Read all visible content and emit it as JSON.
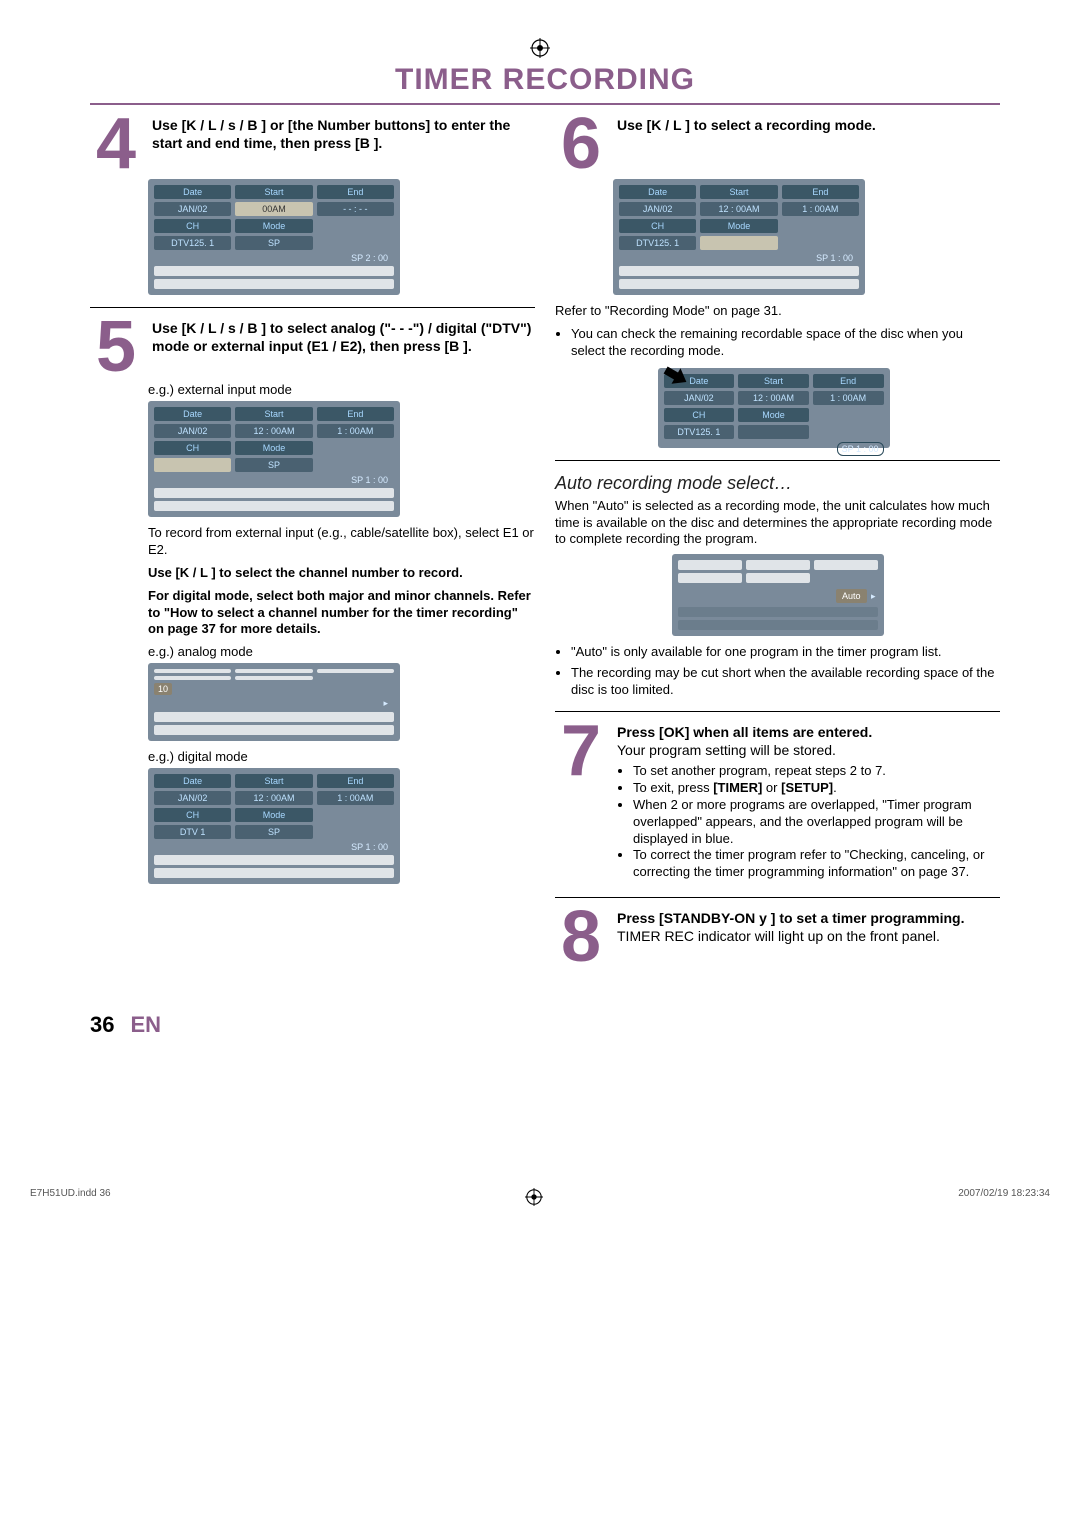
{
  "title": "TIMER RECORDING",
  "left": {
    "step4": {
      "text": "Use [K / L / s / B ] or [the Number buttons] to enter the start and end time, then press [B ].",
      "osd": {
        "headers": [
          "Date",
          "Start",
          "End"
        ],
        "row1": [
          "JAN/02",
          "   00AM",
          "- - : - -"
        ],
        "row2": [
          "CH",
          "Mode",
          ""
        ],
        "row3": [
          "DTV125. 1",
          "SP",
          ""
        ],
        "sp": "SP   2 : 00"
      }
    },
    "step5": {
      "text": "Use [K / L / s / B ] to select analog (\"- - -\") / digital (\"DTV\") mode or external input (E1 / E2), then press [B ].",
      "caption1": "e.g.) external input mode",
      "osd1": {
        "headers": [
          "Date",
          "Start",
          "End"
        ],
        "row1": [
          "JAN/02",
          "12 : 00AM",
          "1 : 00AM"
        ],
        "row2": [
          "CH",
          "Mode",
          ""
        ],
        "row3": [
          "",
          "SP",
          ""
        ],
        "sp": "SP   1 : 00"
      },
      "para1": "To record from external input (e.g., cable/satellite box), select E1 or E2.",
      "bold1": "Use [K / L ] to select the channel number to record.",
      "bold2": "For digital mode, select both major and minor channels. Refer to \"How to select a channel number for the timer recording\" on page 37 for more details.",
      "caption2": "e.g.) analog mode",
      "osd2_badge": "10",
      "caption3": "e.g.) digital mode",
      "osd3": {
        "headers": [
          "Date",
          "Start",
          "End"
        ],
        "row1": [
          "JAN/02",
          "12 : 00AM",
          "1 : 00AM"
        ],
        "row2": [
          "CH",
          "Mode",
          ""
        ],
        "row3": [
          "DTV      1",
          "SP",
          ""
        ],
        "sp": "SP   1 : 00"
      }
    }
  },
  "right": {
    "step6": {
      "text": "Use [K / L ] to select a recording mode.",
      "osd1": {
        "headers": [
          "Date",
          "Start",
          "End"
        ],
        "row1": [
          "JAN/02",
          "12 : 00AM",
          "1 : 00AM"
        ],
        "row2": [
          "CH",
          "Mode",
          ""
        ],
        "row3": [
          "DTV125. 1",
          "",
          ""
        ],
        "sp": "SP   1 : 00"
      },
      "para1": "Refer to \"Recording Mode\" on page 31.",
      "bul1": "You can check the remaining recordable space of the disc when you select the recording mode.",
      "osd2": {
        "headers": [
          "Date",
          "Start",
          "End"
        ],
        "row1": [
          "JAN/02",
          "12 : 00AM",
          "1 : 00AM"
        ],
        "row2": [
          "CH",
          "Mode",
          ""
        ],
        "row3": [
          "DTV125. 1",
          "",
          ""
        ],
        "sp": "SP   1 : 00"
      },
      "subhead": "Auto recording mode select…",
      "para2": "When \"Auto\" is selected as a recording mode, the unit calculates how much time is available on the disc and determines the appropriate recording mode to complete recording the program.",
      "auto_label": "Auto",
      "bul2": "\"Auto\" is only available for one program in the timer program list.",
      "bul3": "The recording may be cut short when the available recording space of the disc is too limited."
    },
    "step7": {
      "text": "Press [OK] when all items are entered.",
      "para": "Your program setting will be stored.",
      "b1": "To set another program, repeat steps 2 to 7.",
      "b2_pre": "To exit, press ",
      "b2_bold": "[TIMER]",
      "b2_mid": " or ",
      "b2_bold2": "[SETUP]",
      "b2_post": ".",
      "b3": "When 2 or more programs are overlapped, \"Timer program overlapped\" appears, and the overlapped program will be displayed in blue.",
      "b4": "To correct the timer program refer to \"Checking, canceling, or correcting the timer programming information\" on page 37."
    },
    "step8": {
      "text": "Press [STANDBY-ON y ] to set a timer programming.",
      "para": "TIMER REC indicator will light up on the front panel."
    }
  },
  "footer": {
    "page": "36",
    "lang": "EN"
  },
  "meta": {
    "left": "E7H51UD.indd   36",
    "right": "2007/02/19   18:23:34"
  }
}
